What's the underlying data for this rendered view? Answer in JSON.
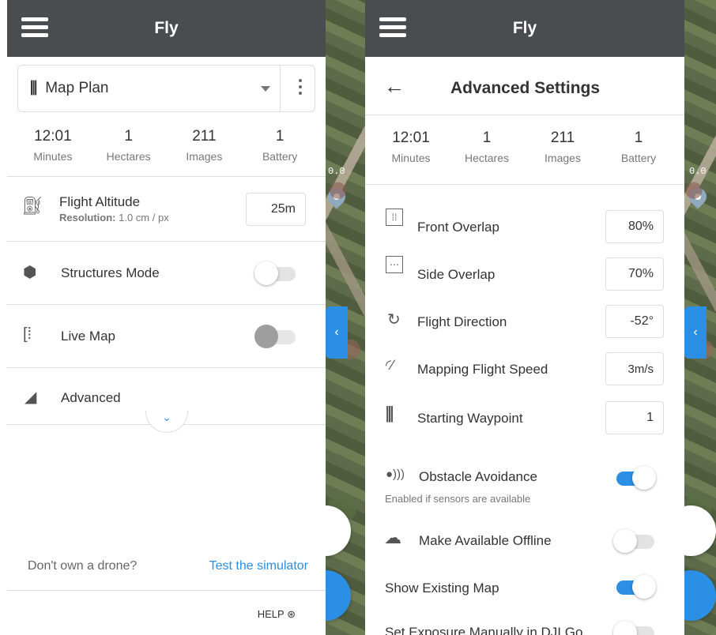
{
  "left": {
    "title": "Fly",
    "plan": {
      "icon": "map-plan-icon",
      "label": "Map Plan"
    },
    "stats": [
      {
        "value": "12:01",
        "label": "Minutes"
      },
      {
        "value": "1",
        "label": "Hectares"
      },
      {
        "value": "211",
        "label": "Images"
      },
      {
        "value": "1",
        "label": "Battery"
      }
    ],
    "altitude": {
      "label": "Flight Altitude",
      "res_label": "Resolution:",
      "res_value": "1.0 cm / px",
      "value": "25m"
    },
    "structures": {
      "label": "Structures Mode",
      "on": false
    },
    "livemap": {
      "label": "Live Map",
      "on": false
    },
    "advanced": {
      "label": "Advanced"
    },
    "footer": {
      "question": "Don't own a drone?",
      "link": "Test the simulator",
      "help": "HELP"
    }
  },
  "right": {
    "title": "Fly",
    "header": "Advanced Settings",
    "stats": [
      {
        "value": "12:01",
        "label": "Minutes"
      },
      {
        "value": "1",
        "label": "Hectares"
      },
      {
        "value": "211",
        "label": "Images"
      },
      {
        "value": "1",
        "label": "Battery"
      }
    ],
    "settings": [
      {
        "label": "Front Overlap",
        "value": "80%",
        "icon": "front-overlap-icon"
      },
      {
        "label": "Side Overlap",
        "value": "70%",
        "icon": "side-overlap-icon"
      },
      {
        "label": "Flight Direction",
        "value": "-52°",
        "icon": "rotate-icon"
      },
      {
        "label": "Mapping Flight Speed",
        "value": "3m/s",
        "icon": "speedometer-icon"
      },
      {
        "label": "Starting Waypoint",
        "value": "1",
        "icon": "waypoint-icon"
      }
    ],
    "obstacle": {
      "label": "Obstacle Avoidance",
      "sub": "Enabled if sensors are available",
      "on": true
    },
    "offline": {
      "label": "Make Available Offline",
      "on": false
    },
    "existing": {
      "label": "Show Existing Map",
      "on": true
    },
    "exposure": {
      "label": "Set Exposure Manually in DJI Go",
      "on": false
    }
  },
  "map": {
    "coord_label": "0.0"
  },
  "colors": {
    "topbar": "#4a4d50",
    "accent": "#2b8fe6",
    "link": "#2b8fe6"
  }
}
